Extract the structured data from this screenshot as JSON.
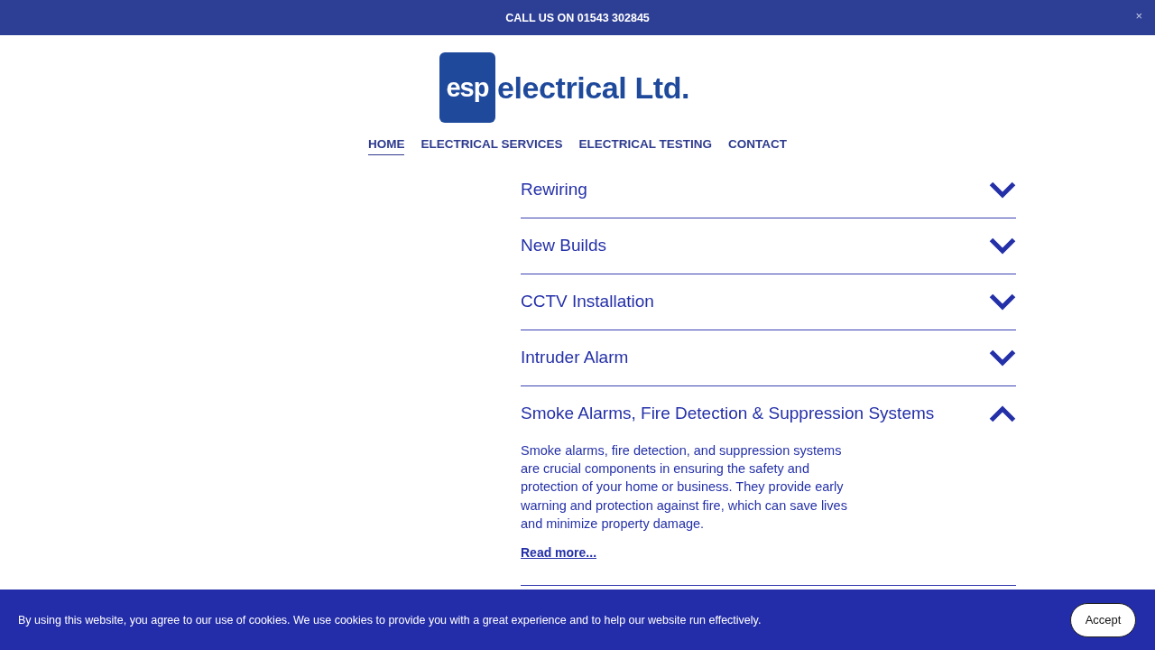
{
  "announcement_bar": {
    "text": "CALL US ON 01543 302845",
    "close": "×"
  },
  "header": {
    "logo": {
      "mark": "esp",
      "name": "electrical Ltd."
    },
    "nav": [
      {
        "label": "HOME",
        "selected": true
      },
      {
        "label": "ELECTRICAL SERVICES",
        "selected": false
      },
      {
        "label": "ELECTRICAL TESTING",
        "selected": false
      },
      {
        "label": "CONTACT",
        "selected": false
      }
    ]
  },
  "accordion": [
    {
      "title": "Rewiring",
      "expanded": false
    },
    {
      "title": "New Builds",
      "expanded": false
    },
    {
      "title": "CCTV Installation",
      "expanded": false
    },
    {
      "title": "Intruder Alarm",
      "expanded": false
    },
    {
      "title": "Smoke Alarms, Fire Detection & Suppression Systems",
      "expanded": true,
      "body": "Smoke alarms, fire detection, and suppression systems are crucial components in ensuring the safety and protection of your home or business. They provide early warning and protection against fire, which can save lives and minimize property damage.",
      "link": "Read more..."
    }
  ],
  "cookie_banner": {
    "text": "By using this website, you agree to our use of cookies. We use cookies to provide you with a great experience and to help our website run effectively.",
    "button": "Accept"
  }
}
